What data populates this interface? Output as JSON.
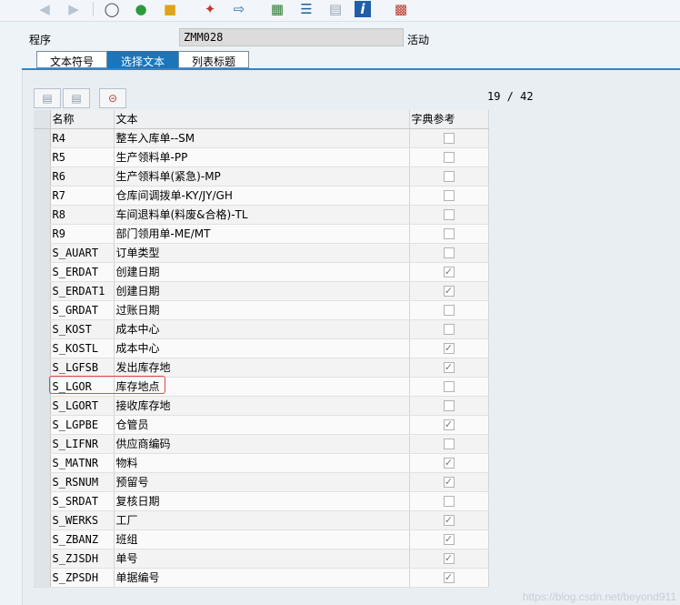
{
  "toolbar": {
    "icons": [
      "back-arrow-icon",
      "forward-arrow-icon",
      "glasses-icon",
      "objects-icon",
      "activate-icon",
      "magic-wand-icon",
      "navigation-icon",
      "hierarchy-icon",
      "stack-icon",
      "document-icon",
      "info-icon",
      "settings-icon"
    ]
  },
  "program": {
    "label": "程序",
    "value": "ZMM028",
    "status": "活动"
  },
  "tabs": [
    {
      "label": "文本符号",
      "active": false
    },
    {
      "label": "选择文本",
      "active": true
    },
    {
      "label": "列表标题",
      "active": false
    }
  ],
  "pager": "19 / 42",
  "table": {
    "columns": [
      "名称",
      "文本",
      "字典参考"
    ],
    "rows": [
      {
        "name": "R4",
        "text": "整车入库单--SM",
        "dict": false
      },
      {
        "name": "R5",
        "text": "生产领料单-PP",
        "dict": false
      },
      {
        "name": "R6",
        "text": "生产领料单(紧急)-MP",
        "dict": false
      },
      {
        "name": "R7",
        "text": "仓库间调拨单-KY/JY/GH",
        "dict": false
      },
      {
        "name": "R8",
        "text": "车间退料单(料废&合格)-TL",
        "dict": false
      },
      {
        "name": "R9",
        "text": "部门领用单-ME/MT",
        "dict": false
      },
      {
        "name": "S_AUART",
        "text": "订单类型",
        "dict": false
      },
      {
        "name": "S_ERDAT",
        "text": "创建日期",
        "dict": true
      },
      {
        "name": "S_ERDAT1",
        "text": "创建日期",
        "dict": true
      },
      {
        "name": "S_GRDAT",
        "text": "过账日期",
        "dict": false
      },
      {
        "name": "S_KOST",
        "text": "成本中心",
        "dict": false
      },
      {
        "name": "S_KOSTL",
        "text": "成本中心",
        "dict": true
      },
      {
        "name": "S_LGFSB",
        "text": "发出库存地",
        "dict": true
      },
      {
        "name": "S_LGOR",
        "text": "库存地点",
        "dict": false
      },
      {
        "name": "S_LGORT",
        "text": "接收库存地",
        "dict": false
      },
      {
        "name": "S_LGPBE",
        "text": "仓管员",
        "dict": true
      },
      {
        "name": "S_LIFNR",
        "text": "供应商编码",
        "dict": false
      },
      {
        "name": "S_MATNR",
        "text": "物料",
        "dict": true
      },
      {
        "name": "S_RSNUM",
        "text": "预留号",
        "dict": true
      },
      {
        "name": "S_SRDAT",
        "text": "复核日期",
        "dict": false
      },
      {
        "name": "S_WERKS",
        "text": "工厂",
        "dict": true
      },
      {
        "name": "S_ZBANZ",
        "text": "班组",
        "dict": true
      },
      {
        "name": "S_ZJSDH",
        "text": "单号",
        "dict": true
      },
      {
        "name": "S_ZPSDH",
        "text": "单据编号",
        "dict": true
      }
    ]
  },
  "watermark": "https://blog.csdn.net/beyond911",
  "colors": {
    "accent": "#1b75bb",
    "highlight": "#e04848"
  }
}
